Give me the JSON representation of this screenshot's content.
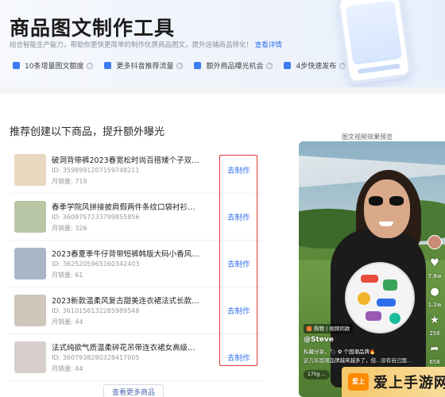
{
  "header": {
    "title": "商品图文制作工具",
    "subtitle": "结合智能生产能力，帮助你更快更简单的制作优质商品图文，提升店铺商品转化！",
    "subtitle_link": "查看详情",
    "features": [
      {
        "label": "10条增量图文额度",
        "icon": "feature-icon"
      },
      {
        "label": "更多抖音推荐流量",
        "icon": "feature-icon"
      },
      {
        "label": "额外商品曝光机会",
        "icon": "feature-icon"
      },
      {
        "label": "4步快速发布",
        "icon": "feature-icon"
      }
    ]
  },
  "section": {
    "title": "推荐创建以下商品，提升额外曝光",
    "more_button": "查看更多商品"
  },
  "products": [
    {
      "name": "破洞背带裤2023春宽松时尚百搭矮个子双拼色...",
      "id": "ID: 3598991207159748211",
      "sales": "月销量: 719",
      "action": "去制作",
      "thumb_color": "#e9d8c0"
    },
    {
      "name": "春季学院风拼接披肩假两件条纹口袋衬衫宽松...",
      "id": "ID: 3609757233799855856",
      "sales": "月销量: 326",
      "action": "去制作",
      "thumb_color": "#b8c6a5"
    },
    {
      "name": "2023春夏季牛仔背带短裤韩版大码小香风宽松...",
      "id": "ID: 3625205965160342403",
      "sales": "月销量: 61",
      "action": "去制作",
      "thumb_color": "#a9b6c6"
    },
    {
      "name": "2023新款温柔风复古甜美连衣裙法式长款小清...",
      "id": "ID: 3610156132285989548",
      "sales": "月销量: 44",
      "action": "去制作",
      "thumb_color": "#cfc6bc"
    },
    {
      "name": "法式纯欲气质温柔碎花吊带连衣裙女高级设计...",
      "id": "ID: 3607938280328417005",
      "sales": "月销量: 44",
      "action": "去制作",
      "thumb_color": "#d8cfcd"
    }
  ],
  "preview": {
    "label": "图文视频效果预览",
    "shop_tag": "购物 | 视频同款",
    "handle": "@Steve",
    "caption1": "私藏分享，🏷 ✿ 个国潮品牌🔥",
    "caption2": "这几年国潮品牌越来越多了，但...没有自己国...",
    "pill": "175g ...",
    "stats": [
      "7.8w",
      "1.2w",
      "256",
      "658"
    ]
  },
  "watermark": {
    "logo": "爱上",
    "text": "爱上手游网"
  }
}
